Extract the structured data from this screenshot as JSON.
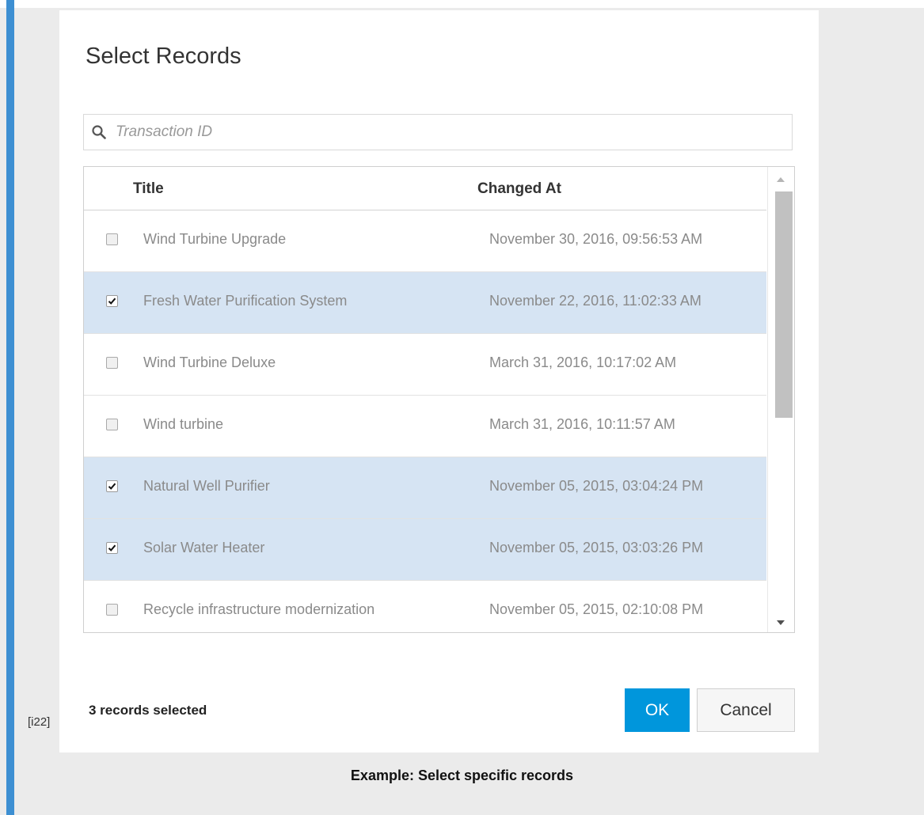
{
  "dialog": {
    "title": "Select Records",
    "search": {
      "placeholder": "Transaction ID",
      "value": ""
    },
    "columns": {
      "title": "Title",
      "changed_at": "Changed At"
    },
    "rows": [
      {
        "title": "Wind Turbine Upgrade",
        "changed_at": "November 30, 2016, 09:56:53 AM",
        "selected": false
      },
      {
        "title": "Fresh Water Purification System",
        "changed_at": "November 22, 2016, 11:02:33 AM",
        "selected": true
      },
      {
        "title": "Wind Turbine Deluxe",
        "changed_at": "March 31, 2016, 10:17:02 AM",
        "selected": false
      },
      {
        "title": "Wind turbine",
        "changed_at": "March 31, 2016, 10:11:57 AM",
        "selected": false
      },
      {
        "title": "Natural Well Purifier",
        "changed_at": "November 05, 2015, 03:04:24 PM",
        "selected": true
      },
      {
        "title": "Solar Water Heater",
        "changed_at": "November 05, 2015, 03:03:26 PM",
        "selected": true
      },
      {
        "title": "Recycle infrastructure modernization",
        "changed_at": "November 05, 2015, 02:10:08 PM",
        "selected": false
      }
    ],
    "selected_count_text": "3 records selected",
    "ok_label": "OK",
    "cancel_label": "Cancel"
  },
  "figure": {
    "ref_tag": "[i22]",
    "caption": "Example: Select specific records"
  },
  "colors": {
    "accent_bar": "#3d8fd2",
    "ok_button": "#0096dc",
    "selected_row": "#d6e4f3",
    "page_background": "#ebebeb"
  },
  "icons": {
    "search": "search-icon",
    "checkbox_checked": "checkmark-icon",
    "scroll_up": "chevron-up-icon",
    "scroll_down": "chevron-down-icon"
  }
}
